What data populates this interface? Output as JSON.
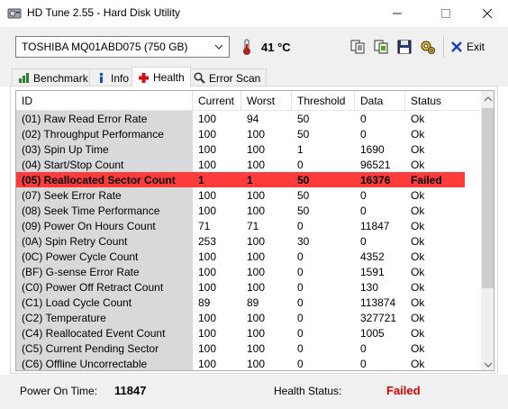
{
  "window": {
    "title": "HD Tune 2.55 - Hard Disk Utility",
    "controls": {
      "minimize": "—",
      "maximize": "☐",
      "close": "✕"
    }
  },
  "toolbar": {
    "drive": "TOSHIBA MQ01ABD075 (750 GB)",
    "temperature": "41 °C",
    "exit_label": "Exit",
    "buttons": [
      "copy-icon",
      "copy-screen-icon",
      "save-icon",
      "options-icon",
      "exit-icon"
    ]
  },
  "tabs": [
    {
      "label": "Benchmark",
      "icon": "benchmark-icon",
      "active": false
    },
    {
      "label": "Info",
      "icon": "info-icon",
      "active": false
    },
    {
      "label": "Health",
      "icon": "health-icon",
      "active": true
    },
    {
      "label": "Error Scan",
      "icon": "magnifier-icon",
      "active": false
    }
  ],
  "table": {
    "columns": [
      "ID",
      "Current",
      "Worst",
      "Threshold",
      "Data",
      "Status"
    ],
    "rows": [
      [
        "(01) Raw Read Error Rate",
        "100",
        "94",
        "50",
        "0",
        "Ok"
      ],
      [
        "(02) Throughput Performance",
        "100",
        "100",
        "50",
        "0",
        "Ok"
      ],
      [
        "(03) Spin Up Time",
        "100",
        "100",
        "1",
        "1690",
        "Ok"
      ],
      [
        "(04) Start/Stop Count",
        "100",
        "100",
        "0",
        "96521",
        "Ok"
      ],
      [
        "(05) Reallocated Sector Count",
        "1",
        "1",
        "50",
        "16376",
        "Failed"
      ],
      [
        "(07) Seek Error Rate",
        "100",
        "100",
        "50",
        "0",
        "Ok"
      ],
      [
        "(08) Seek Time Performance",
        "100",
        "100",
        "50",
        "0",
        "Ok"
      ],
      [
        "(09) Power On Hours Count",
        "71",
        "71",
        "0",
        "11847",
        "Ok"
      ],
      [
        "(0A) Spin Retry Count",
        "253",
        "100",
        "30",
        "0",
        "Ok"
      ],
      [
        "(0C) Power Cycle Count",
        "100",
        "100",
        "0",
        "4352",
        "Ok"
      ],
      [
        "(BF) G-sense Error Rate",
        "100",
        "100",
        "0",
        "1591",
        "Ok"
      ],
      [
        "(C0) Power Off Retract Count",
        "100",
        "100",
        "0",
        "130",
        "Ok"
      ],
      [
        "(C1) Load Cycle Count",
        "89",
        "89",
        "0",
        "113874",
        "Ok"
      ],
      [
        "(C2) Temperature",
        "100",
        "100",
        "0",
        "327721",
        "Ok"
      ],
      [
        "(C4) Reallocated Event Count",
        "100",
        "100",
        "0",
        "1005",
        "Ok"
      ],
      [
        "(C5) Current Pending Sector",
        "100",
        "100",
        "0",
        "0",
        "Ok"
      ],
      [
        "(C6) Offline Uncorrectable",
        "100",
        "100",
        "0",
        "0",
        "Ok"
      ]
    ],
    "failed_row_color": "#ff3b3b"
  },
  "footer": {
    "power_on_label": "Power On Time:",
    "power_on_value": "11847",
    "health_label": "Health Status:",
    "health_value": "Failed",
    "health_color": "#e00000"
  }
}
